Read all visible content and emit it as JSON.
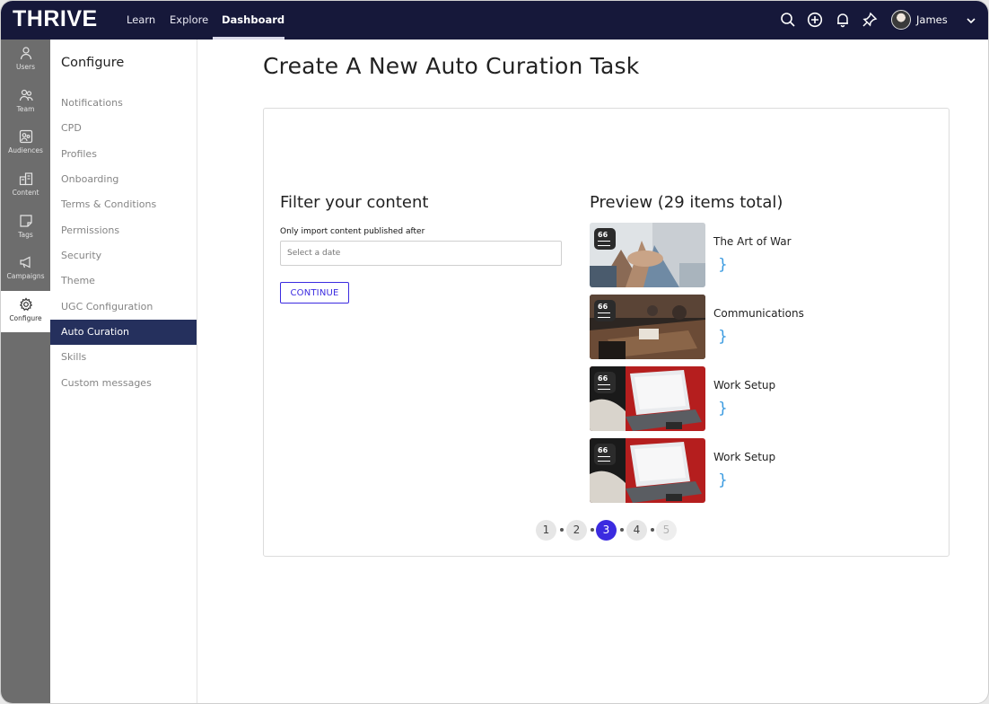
{
  "topbar": {
    "logo": "THRIVE",
    "nav": [
      "Learn",
      "Explore",
      "Dashboard"
    ],
    "active_nav": "Dashboard",
    "user_name": "James"
  },
  "rail": {
    "items": [
      {
        "label": "Users",
        "icon": "user-icon"
      },
      {
        "label": "Team",
        "icon": "team-icon"
      },
      {
        "label": "Audiences",
        "icon": "audience-icon"
      },
      {
        "label": "Content",
        "icon": "content-icon"
      },
      {
        "label": "Tags",
        "icon": "tag-icon"
      },
      {
        "label": "Campaigns",
        "icon": "megaphone-icon"
      },
      {
        "label": "Configure",
        "icon": "gear-icon"
      }
    ],
    "active": "Configure"
  },
  "sidebar": {
    "title": "Configure",
    "items": [
      "Notifications",
      "CPD",
      "Profiles",
      "Onboarding",
      "Terms & Conditions",
      "Permissions",
      "Security",
      "Theme",
      "UGC Configuration",
      "Auto Curation",
      "Skills",
      "Custom messages"
    ],
    "active": "Auto Curation"
  },
  "main": {
    "title": "Create A New Auto Curation Task",
    "filter": {
      "heading": "Filter your content",
      "date_label": "Only import content published after",
      "date_placeholder": "Select a date",
      "continue_label": "CONTINUE"
    },
    "preview": {
      "heading": "Preview (29 items total)",
      "items": [
        {
          "title": "The Art of War",
          "brace": "}",
          "badge": "66"
        },
        {
          "title": "Communications",
          "brace": "}",
          "badge": "66"
        },
        {
          "title": "Work Setup",
          "brace": "}",
          "badge": "66"
        },
        {
          "title": "Work Setup",
          "brace": "}",
          "badge": "66"
        }
      ]
    },
    "pagination": {
      "pages": [
        "1",
        "2",
        "3",
        "4",
        "5"
      ],
      "current": "3"
    }
  },
  "colors": {
    "topbar": "#16183a",
    "accent": "#3b2be0",
    "sidebar_active": "#25305d",
    "rail": "#6d6d6d",
    "brace": "#3b9be0"
  }
}
